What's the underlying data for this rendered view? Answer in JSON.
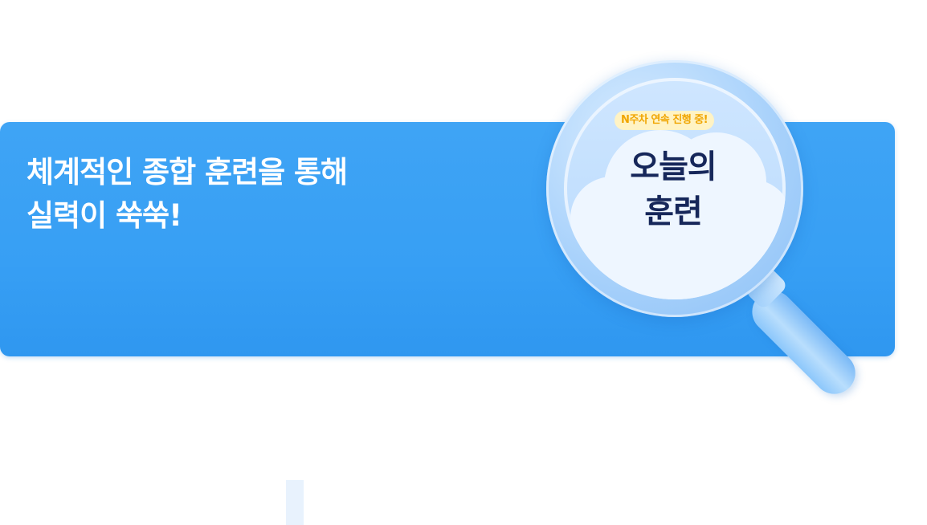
{
  "banner": {
    "headline_line1": "체계적인 종합 훈련을 통해",
    "headline_line2": "실력이 쑥쑥!"
  },
  "magnifier": {
    "badge": "N주차 연속 진행 중!",
    "title_line1": "오늘의",
    "title_line2": "훈련"
  },
  "colors": {
    "banner_blue": "#3aa2f5",
    "title_navy": "#16275a",
    "badge_bg": "#fff3c4",
    "badge_text": "#f0a500"
  }
}
